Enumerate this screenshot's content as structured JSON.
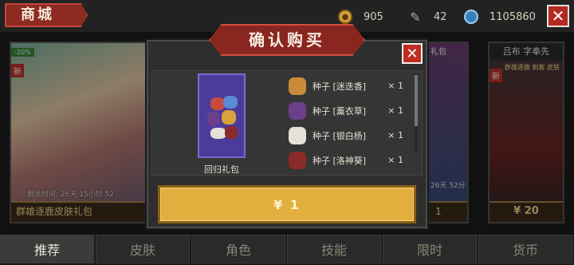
{
  "header": {
    "title": "商城",
    "gold": "905",
    "feather": "42",
    "gems": "1105860",
    "close_symbol": "✕"
  },
  "cards": {
    "left": {
      "discount": "-20%",
      "new_badge": "新",
      "timer": "剩余时间: 26天 15小时 52",
      "name": "群雄逐鹿皮肤礼包",
      "price_peek": "¥"
    },
    "middle": {
      "label": "礼包",
      "timer": "26天 52分",
      "price_peek": "1"
    },
    "right": {
      "name": "吕布 字奉先",
      "new_badge": "新",
      "skin_tag": "群雄逐鹿 刺客 皮肤",
      "price": "¥ 20"
    }
  },
  "modal": {
    "title": "确认购买",
    "close_symbol": "✕",
    "pack_name": "回归礼包",
    "items": [
      {
        "name": "种子 [迷迭香]",
        "qty": "× 1",
        "color": "#c98a3a"
      },
      {
        "name": "种子 [薰衣草]",
        "qty": "× 1",
        "color": "#6b3f8a"
      },
      {
        "name": "种子 [银白杨]",
        "qty": "× 1",
        "color": "#e5e0d8"
      },
      {
        "name": "种子 [洛神葵]",
        "qty": "× 1",
        "color": "#8a2a2a"
      }
    ],
    "buy_label": "¥ 1"
  },
  "tabs": [
    "推荐",
    "皮肤",
    "角色",
    "技能",
    "限时",
    "货币"
  ],
  "colors": {
    "accent_red": "#8a2620",
    "buy_gold": "#e2ae3e",
    "price_gold": "#f3d98d"
  }
}
